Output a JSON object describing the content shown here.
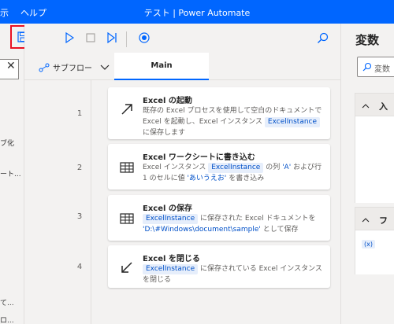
{
  "titlebar": {
    "menu_partial": "示",
    "help": "ヘルプ",
    "title": "テスト | Power Automate"
  },
  "left_panel": {
    "items": [
      "ブ化",
      "ート...",
      "て...",
      "ロ..."
    ]
  },
  "tabs": {
    "subflow": "サブフロー",
    "main": "Main"
  },
  "steps": [
    {
      "num": "1",
      "title": "Excel の起動",
      "icon": "arrow-up-right-icon",
      "desc": {
        "t1": "既存の Excel プロセスを使用して空白のドキュメントで Excel を起動し、Excel インスタンス ",
        "chip": "ExcelInstance",
        "t2": " に保存します"
      }
    },
    {
      "num": "2",
      "title": "Excel ワークシートに書き込む",
      "icon": "excel-grid-icon",
      "desc": {
        "t1": "Excel インスタンス ",
        "chip": "ExcelInstance",
        "t2": " の列 ",
        "q1": "'A'",
        "t3": " および行 1 のセルに値 ",
        "q2": "'あいうえお'",
        "t4": " を書き込み"
      }
    },
    {
      "num": "3",
      "title": "Excel の保存",
      "icon": "excel-grid-icon",
      "desc": {
        "chip": "ExcelInstance",
        "t1": " に保存された Excel ドキュメントを ",
        "q1": "'D:\\#Windows\\document\\sample'",
        "t2": " として保存"
      }
    },
    {
      "num": "4",
      "title": "Excel を閉じる",
      "icon": "arrow-down-left-icon",
      "desc": {
        "chip": "ExcelInstance",
        "t1": " に保存されている Excel インスタンスを閉じる"
      }
    }
  ],
  "right_panel": {
    "title": "変数",
    "search_placeholder": "変数",
    "section1": "入",
    "section2": "フ",
    "var_chip": "(x)"
  },
  "colors": {
    "accent": "#0066ff",
    "highlight_border": "#e81123"
  }
}
